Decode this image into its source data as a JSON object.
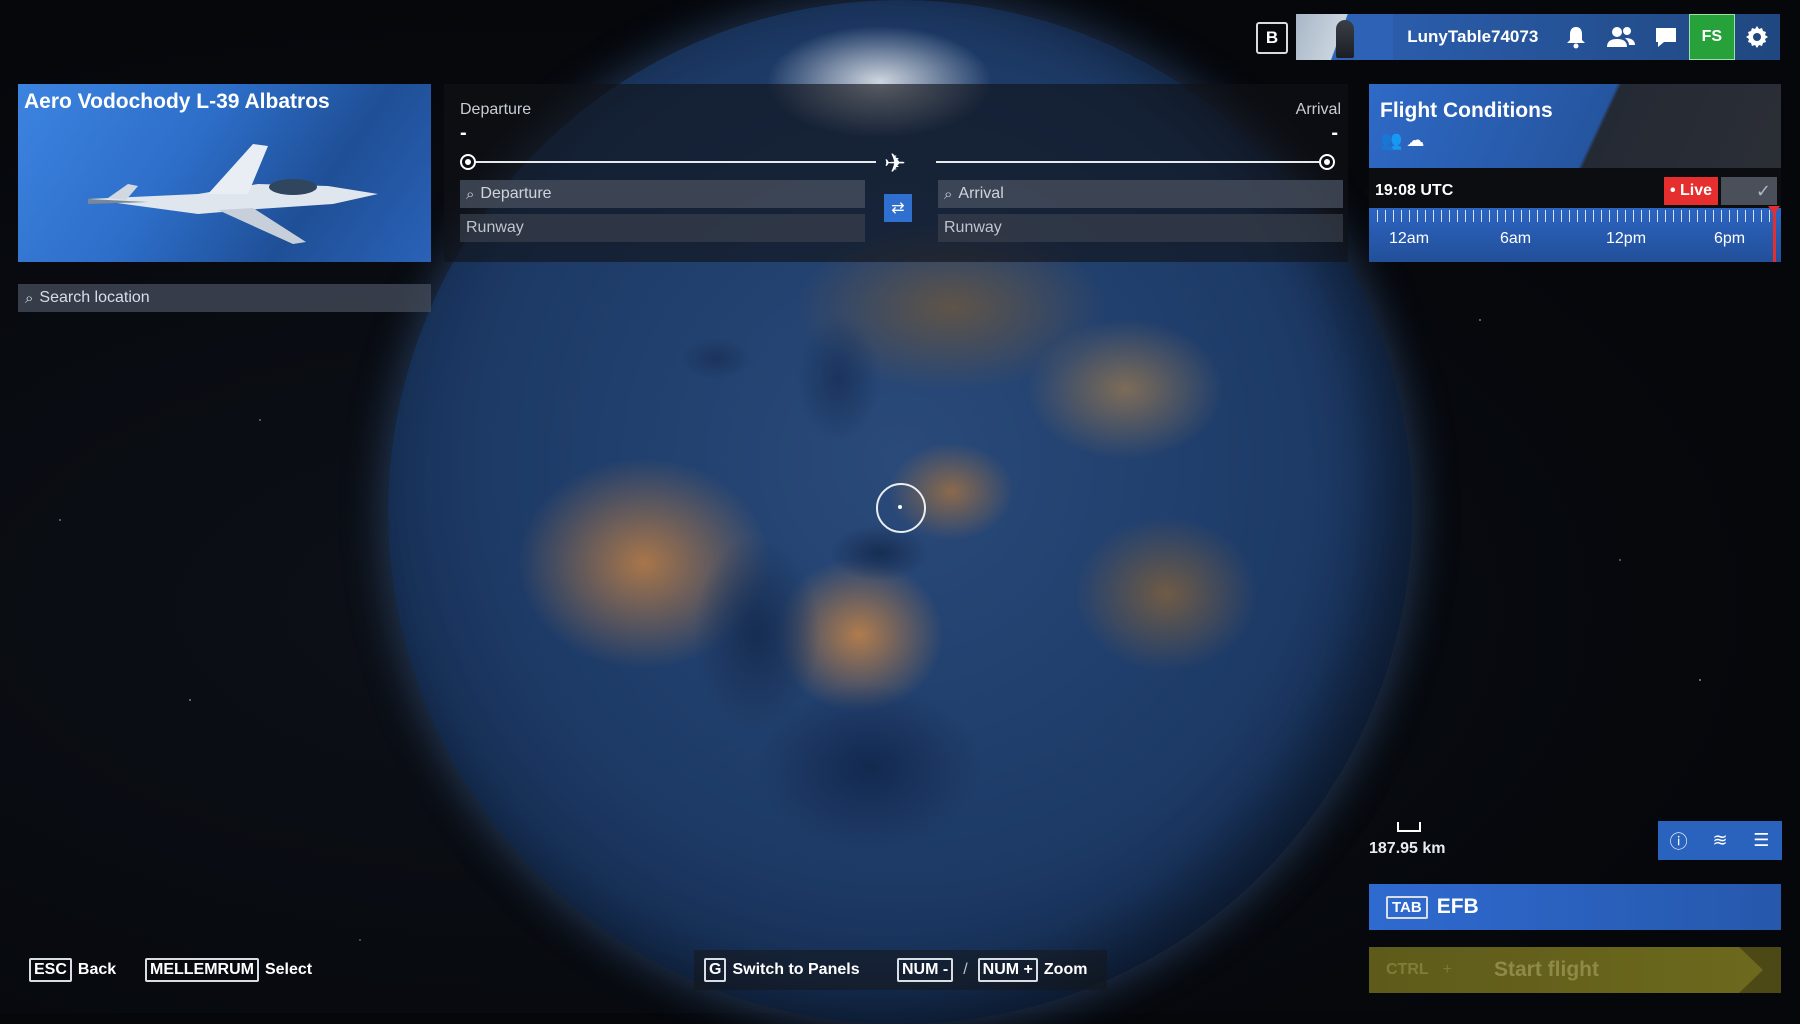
{
  "topbar": {
    "b_key": "B",
    "username": "LunyTable74073",
    "icons": [
      "bell-icon",
      "friends-icon",
      "chat-icon",
      "fs-store-icon",
      "gear-icon"
    ],
    "store_glyph": "FS"
  },
  "aircraft": {
    "name": "Aero Vodochody L-39 Albatros"
  },
  "search": {
    "placeholder": "Search location"
  },
  "route": {
    "departure_label": "Departure",
    "arrival_label": "Arrival",
    "departure_dash": "-",
    "arrival_dash": "-",
    "departure_field": "Departure",
    "arrival_field": "Arrival",
    "departure_runway": "Runway",
    "arrival_runway": "Runway"
  },
  "conditions": {
    "title": "Flight Conditions",
    "time": "19:08 UTC",
    "live_label": "• Live",
    "timeline_labels": [
      "12am",
      "6am",
      "12pm",
      "6pm"
    ]
  },
  "map": {
    "scale": "187.95 km"
  },
  "efb": {
    "key": "TAB",
    "label": "EFB"
  },
  "start": {
    "key": "CTRL",
    "plus": "+",
    "label": "Start flight"
  },
  "hints": {
    "esc_key": "ESC",
    "esc_label": "Back",
    "select_key": "MELLEMRUM",
    "select_label": "Select",
    "g_key": "G",
    "g_label": "Switch to Panels",
    "num_minus": "NUM -",
    "slash": "/",
    "num_plus": "NUM +",
    "zoom_label": "Zoom"
  },
  "colors": {
    "accent": "#2d62b6",
    "live": "#e62e2e",
    "store": "#27a23b",
    "start": "#6d6a1e"
  }
}
